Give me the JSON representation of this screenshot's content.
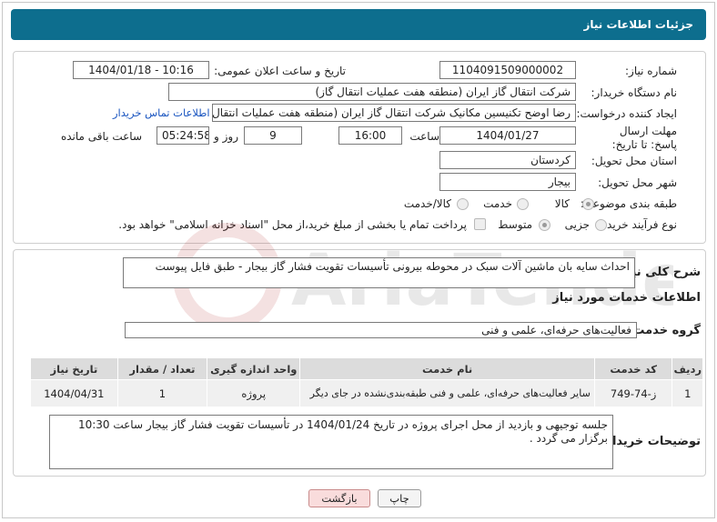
{
  "header": {
    "title": "جزئیات اطلاعات نیاز"
  },
  "fields": {
    "need_number_label": "شماره نیاز:",
    "need_number": "1104091509000002",
    "announce_label": "تاریخ و ساعت اعلان عمومی:",
    "announce_value": "1404/01/18 - 10:16",
    "buyer_org_label": "نام دستگاه خریدار:",
    "buyer_org": "شرکت انتقال گاز ایران (منطقه هفت عملیات انتقال گاز)",
    "requester_label": "ایجاد کننده درخواست:",
    "requester": "رضا اوضح تکنیسین مکانیک شرکت انتقال گاز ایران (منطقه هفت عملیات انتقال گاز)",
    "contact_link": "اطلاعات تماس خریدار",
    "deadline_label": "مهلت ارسال پاسخ: تا تاریخ:",
    "deadline_date": "1404/01/27",
    "time_label": "ساعت",
    "deadline_time": "16:00",
    "days_value": "9",
    "days_label": "روز و",
    "remaining_time": "05:24:58",
    "remaining_label": "ساعت باقی مانده",
    "province_label": "استان محل تحویل:",
    "province": "کردستان",
    "city_label": "شهر محل تحویل:",
    "city": "بیجار",
    "category_label": "طبقه بندی موضوعی:",
    "category_options": [
      "کالا",
      "خدمت",
      "کالا/خدمت"
    ],
    "purchase_type_label": "نوع فرآیند خرید :",
    "purchase_type_options": [
      "جزیی",
      "متوسط"
    ],
    "payment_note": "پرداخت تمام یا بخشی از مبلغ خرید،از محل \"اسناد خزانه اسلامی\" خواهد بود."
  },
  "summary": {
    "label": "شرح کلی نیاز:",
    "text": "احداث سایه بان ماشین آلات سبک در محوطه بیرونی تأسیسات تقویت فشار گاز بیجار - طبق فایل پیوست"
  },
  "services": {
    "section_title": "اطلاعات خدمات مورد نیاز",
    "group_label": "گروه خدمت:",
    "group_value": "فعالیت‌های حرفه‌ای، علمی و فنی",
    "columns": [
      "ردیف",
      "کد خدمت",
      "نام خدمت",
      "واحد اندازه گیری",
      "تعداد / مقدار",
      "تاریخ نیاز"
    ],
    "rows": [
      [
        "1",
        "ز-74-749",
        "سایر فعالیت‌های حرفه‌ای، علمی و فنی طبقه‌بندی‌نشده در جای دیگر",
        "پروژه",
        "1",
        "1404/04/31"
      ]
    ]
  },
  "buyer_notes": {
    "label": "توضیحات خریدار:",
    "text": "جلسه توجیهی و بازدید از محل اجرای پروژه در تاریخ 1404/01/24 در تأسیسات تقویت فشار گاز بیجار ساعت 10:30 برگزار می گردد ."
  },
  "buttons": {
    "print": "چاپ",
    "back": "بازگشت"
  },
  "watermark": {
    "text": "AriaTender.neT"
  },
  "colors": {
    "header": "#0d6e8e",
    "link": "#1a55c0",
    "back_button": "#f9dcdc"
  }
}
